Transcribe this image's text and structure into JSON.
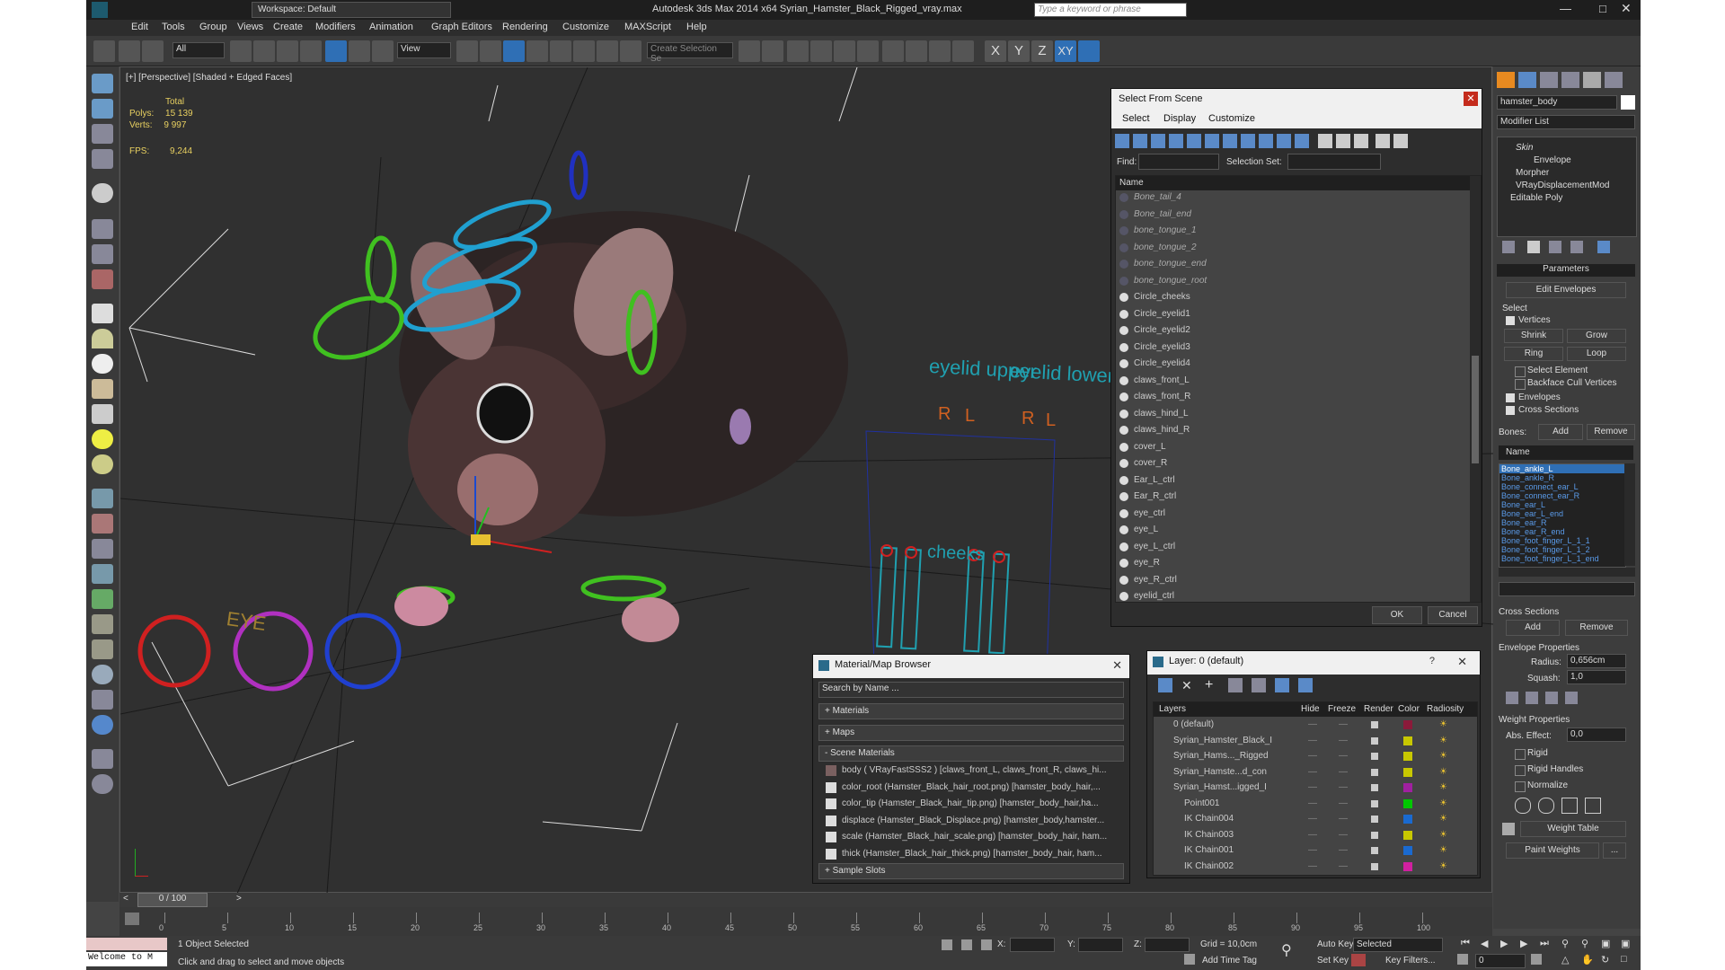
{
  "app": {
    "title": "Autodesk 3ds Max  2014 x64     Syrian_Hamster_Black_Rigged_vray.max",
    "workspace": "Workspace: Default",
    "search_placeholder": "Type a keyword or phrase"
  },
  "menu": [
    "Edit",
    "Tools",
    "Group",
    "Views",
    "Create",
    "Modifiers",
    "Animation",
    "Graph Editors",
    "Rendering",
    "Customize",
    "MAXScript",
    "Help"
  ],
  "toolbar": {
    "filter": "All",
    "view": "View",
    "create_selection_set": "Create Selection Se",
    "axes": [
      "X",
      "Y",
      "Z",
      "XY"
    ]
  },
  "viewport": {
    "label": "[+] [Perspective] [Shaded + Edged Faces]",
    "stats": {
      "total_label": "Total",
      "polys_label": "Polys:",
      "polys": "15 139",
      "verts_label": "Verts:",
      "verts": "9 997",
      "fps_label": "FPS:",
      "fps": "9,244"
    },
    "ctrl_labels": {
      "eyelid_upper": "eyelid upper",
      "eyelid_lower": "eyelid lower",
      "r": "R",
      "l": "L",
      "cheeks": "cheeks",
      "eye": "EYE"
    }
  },
  "select_from_scene": {
    "title": "Select From Scene",
    "menu": [
      "Select",
      "Display",
      "Customize"
    ],
    "find_label": "Find:",
    "selection_set_label": "Selection Set:",
    "column": "Name",
    "items": [
      "Bone_tail_4",
      "Bone_tail_end",
      "bone_tongue_1",
      "bone_tongue_2",
      "bone_tongue_end",
      "bone_tongue_root",
      "Circle_cheeks",
      "Circle_eyelid1",
      "Circle_eyelid2",
      "Circle_eyelid3",
      "Circle_eyelid4",
      "claws_front_L",
      "claws_front_R",
      "claws_hind_L",
      "claws_hind_R",
      "cover_L",
      "cover_R",
      "Ear_L_ctrl",
      "Ear_R_ctrl",
      "eye_ctrl",
      "eye_L",
      "eye_L_ctrl",
      "eye_R",
      "eye_R_ctrl",
      "eyelid_ctrl"
    ],
    "ok": "OK",
    "cancel": "Cancel"
  },
  "material_browser": {
    "title": "Material/Map Browser",
    "search": "Search by Name ...",
    "sections": [
      "+ Materials",
      "+ Maps",
      "- Scene Materials",
      "+ Sample Slots"
    ],
    "scene_materials": [
      "body  ( VRayFastSSS2 ) [claws_front_L, claws_front_R, claws_hi...",
      "color_root (Hamster_Black_hair_root.png) [hamster_body_hair,...",
      "color_tip (Hamster_Black_hair_tip.png) [hamster_body_hair,ha...",
      "displace (Hamster_Black_Displace.png) [hamster_body,hamster...",
      "scale (Hamster_Black_hair_scale.png) [hamster_body_hair, ham...",
      "thick (Hamster_Black_hair_thick.png) [hamster_body_hair, ham..."
    ]
  },
  "layer_dialog": {
    "title": "Layer: 0 (default)",
    "columns": [
      "Layers",
      "Hide",
      "Freeze",
      "Render",
      "Color",
      "Radiosity"
    ],
    "rows": [
      {
        "name": "0 (default)",
        "color": "#8b1a3a"
      },
      {
        "name": "Syrian_Hamster_Black_I",
        "color": "#c8c800"
      },
      {
        "name": "Syrian_Hams..._Rigged",
        "color": "#c8c800"
      },
      {
        "name": "Syrian_Hamste...d_con",
        "color": "#c8c800"
      },
      {
        "name": "Syrian_Hamst...igged_I",
        "color": "#a020a0"
      },
      {
        "name": "Point001",
        "color": "#00c800"
      },
      {
        "name": "IK Chain004",
        "color": "#1a6ad0"
      },
      {
        "name": "IK Chain003",
        "color": "#c8c800"
      },
      {
        "name": "IK Chain001",
        "color": "#1a6ad0"
      },
      {
        "name": "IK Chain002",
        "color": "#d020a0"
      }
    ]
  },
  "command_panel": {
    "object_name": "hamster_body",
    "modifier_list": "Modifier List",
    "stack": [
      "Skin",
      "Envelope",
      "Morpher",
      "VRayDisplacementMod",
      "Editable Poly"
    ],
    "parameters": "Parameters",
    "edit_envelopes": "Edit Envelopes",
    "select_label": "Select",
    "vertices": "Vertices",
    "shrink": "Shrink",
    "grow": "Grow",
    "ring": "Ring",
    "loop": "Loop",
    "select_element": "Select Element",
    "backface": "Backface Cull Vertices",
    "envelopes": "Envelopes",
    "cross_sections": "Cross Sections",
    "bones_label": "Bones:",
    "add": "Add",
    "remove": "Remove",
    "name_col": "Name",
    "bones": [
      "Bone_ankle_L",
      "Bone_ankle_R",
      "Bone_connect_ear_L",
      "Bone_connect_ear_R",
      "Bone_ear_L",
      "Bone_ear_L_end",
      "Bone_ear_R",
      "Bone_ear_R_end",
      "Bone_foot_finger_L_1_1",
      "Bone_foot_finger_L_1_2",
      "Bone_foot_finger_L_1_end"
    ],
    "cross_sections_group": "Cross Sections",
    "envelope_props": "Envelope Properties",
    "radius_label": "Radius:",
    "radius": "0,656cm",
    "squash_label": "Squash:",
    "squash": "1,0",
    "weight_props": "Weight Properties",
    "abs_effect_label": "Abs. Effect:",
    "abs_effect": "0,0",
    "rigid": "Rigid",
    "rigid_handles": "Rigid Handles",
    "normalize": "Normalize",
    "weight_table": "Weight Table",
    "paint_weights": "Paint Weights"
  },
  "timeline": {
    "frame": "0 / 100",
    "ticks": [
      "0",
      "5",
      "10",
      "15",
      "20",
      "25",
      "30",
      "35",
      "40",
      "45",
      "50",
      "55",
      "60",
      "65",
      "70",
      "75",
      "80",
      "85",
      "90",
      "95",
      "100"
    ]
  },
  "status": {
    "welcome": "Welcome to M",
    "selected": "1 Object Selected",
    "hint": "Click and drag to select and move objects",
    "x_label": "X:",
    "y_label": "Y:",
    "z_label": "Z:",
    "grid": "Grid = 10,0cm",
    "add_time_tag": "Add Time Tag",
    "auto_key": "Auto Key",
    "set_key": "Set Key",
    "selected_dd": "Selected",
    "key_filters": "Key Filters...",
    "frame": "0"
  }
}
